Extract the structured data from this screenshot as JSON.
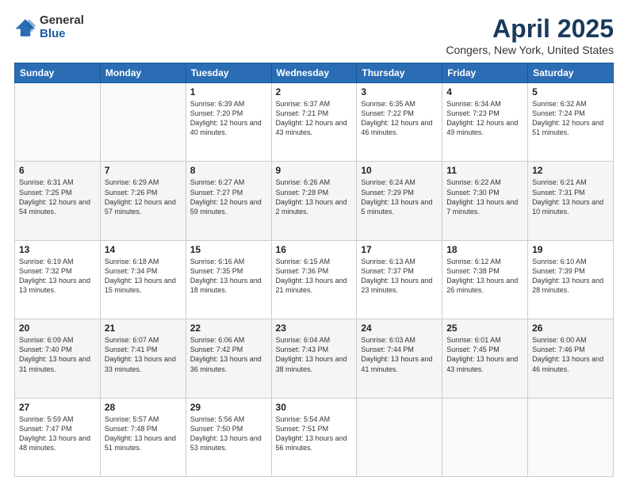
{
  "header": {
    "logo_general": "General",
    "logo_blue": "Blue",
    "title": "April 2025",
    "subtitle": "Congers, New York, United States"
  },
  "weekdays": [
    "Sunday",
    "Monday",
    "Tuesday",
    "Wednesday",
    "Thursday",
    "Friday",
    "Saturday"
  ],
  "weeks": [
    [
      {
        "day": "",
        "info": ""
      },
      {
        "day": "",
        "info": ""
      },
      {
        "day": "1",
        "info": "Sunrise: 6:39 AM\nSunset: 7:20 PM\nDaylight: 12 hours\nand 40 minutes."
      },
      {
        "day": "2",
        "info": "Sunrise: 6:37 AM\nSunset: 7:21 PM\nDaylight: 12 hours\nand 43 minutes."
      },
      {
        "day": "3",
        "info": "Sunrise: 6:35 AM\nSunset: 7:22 PM\nDaylight: 12 hours\nand 46 minutes."
      },
      {
        "day": "4",
        "info": "Sunrise: 6:34 AM\nSunset: 7:23 PM\nDaylight: 12 hours\nand 49 minutes."
      },
      {
        "day": "5",
        "info": "Sunrise: 6:32 AM\nSunset: 7:24 PM\nDaylight: 12 hours\nand 51 minutes."
      }
    ],
    [
      {
        "day": "6",
        "info": "Sunrise: 6:31 AM\nSunset: 7:25 PM\nDaylight: 12 hours\nand 54 minutes."
      },
      {
        "day": "7",
        "info": "Sunrise: 6:29 AM\nSunset: 7:26 PM\nDaylight: 12 hours\nand 57 minutes."
      },
      {
        "day": "8",
        "info": "Sunrise: 6:27 AM\nSunset: 7:27 PM\nDaylight: 12 hours\nand 59 minutes."
      },
      {
        "day": "9",
        "info": "Sunrise: 6:26 AM\nSunset: 7:28 PM\nDaylight: 13 hours\nand 2 minutes."
      },
      {
        "day": "10",
        "info": "Sunrise: 6:24 AM\nSunset: 7:29 PM\nDaylight: 13 hours\nand 5 minutes."
      },
      {
        "day": "11",
        "info": "Sunrise: 6:22 AM\nSunset: 7:30 PM\nDaylight: 13 hours\nand 7 minutes."
      },
      {
        "day": "12",
        "info": "Sunrise: 6:21 AM\nSunset: 7:31 PM\nDaylight: 13 hours\nand 10 minutes."
      }
    ],
    [
      {
        "day": "13",
        "info": "Sunrise: 6:19 AM\nSunset: 7:32 PM\nDaylight: 13 hours\nand 13 minutes."
      },
      {
        "day": "14",
        "info": "Sunrise: 6:18 AM\nSunset: 7:34 PM\nDaylight: 13 hours\nand 15 minutes."
      },
      {
        "day": "15",
        "info": "Sunrise: 6:16 AM\nSunset: 7:35 PM\nDaylight: 13 hours\nand 18 minutes."
      },
      {
        "day": "16",
        "info": "Sunrise: 6:15 AM\nSunset: 7:36 PM\nDaylight: 13 hours\nand 21 minutes."
      },
      {
        "day": "17",
        "info": "Sunrise: 6:13 AM\nSunset: 7:37 PM\nDaylight: 13 hours\nand 23 minutes."
      },
      {
        "day": "18",
        "info": "Sunrise: 6:12 AM\nSunset: 7:38 PM\nDaylight: 13 hours\nand 26 minutes."
      },
      {
        "day": "19",
        "info": "Sunrise: 6:10 AM\nSunset: 7:39 PM\nDaylight: 13 hours\nand 28 minutes."
      }
    ],
    [
      {
        "day": "20",
        "info": "Sunrise: 6:09 AM\nSunset: 7:40 PM\nDaylight: 13 hours\nand 31 minutes."
      },
      {
        "day": "21",
        "info": "Sunrise: 6:07 AM\nSunset: 7:41 PM\nDaylight: 13 hours\nand 33 minutes."
      },
      {
        "day": "22",
        "info": "Sunrise: 6:06 AM\nSunset: 7:42 PM\nDaylight: 13 hours\nand 36 minutes."
      },
      {
        "day": "23",
        "info": "Sunrise: 6:04 AM\nSunset: 7:43 PM\nDaylight: 13 hours\nand 38 minutes."
      },
      {
        "day": "24",
        "info": "Sunrise: 6:03 AM\nSunset: 7:44 PM\nDaylight: 13 hours\nand 41 minutes."
      },
      {
        "day": "25",
        "info": "Sunrise: 6:01 AM\nSunset: 7:45 PM\nDaylight: 13 hours\nand 43 minutes."
      },
      {
        "day": "26",
        "info": "Sunrise: 6:00 AM\nSunset: 7:46 PM\nDaylight: 13 hours\nand 46 minutes."
      }
    ],
    [
      {
        "day": "27",
        "info": "Sunrise: 5:59 AM\nSunset: 7:47 PM\nDaylight: 13 hours\nand 48 minutes."
      },
      {
        "day": "28",
        "info": "Sunrise: 5:57 AM\nSunset: 7:48 PM\nDaylight: 13 hours\nand 51 minutes."
      },
      {
        "day": "29",
        "info": "Sunrise: 5:56 AM\nSunset: 7:50 PM\nDaylight: 13 hours\nand 53 minutes."
      },
      {
        "day": "30",
        "info": "Sunrise: 5:54 AM\nSunset: 7:51 PM\nDaylight: 13 hours\nand 56 minutes."
      },
      {
        "day": "",
        "info": ""
      },
      {
        "day": "",
        "info": ""
      },
      {
        "day": "",
        "info": ""
      }
    ]
  ]
}
